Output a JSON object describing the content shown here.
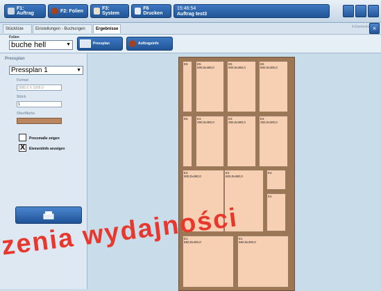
{
  "toolbar": {
    "buttons": [
      {
        "label": "F1: Auftrag",
        "icon": "notes-icon",
        "color": "#cfd7e0"
      },
      {
        "label": "F2: Folien",
        "icon": "folie-roll-icon",
        "color": "#a4421f"
      },
      {
        "label": "F3: System",
        "icon": "tools-icon",
        "color": "#e9e0c9"
      },
      {
        "label": "F6 Drucken",
        "icon": "printer-icon",
        "color": "#e6ecf2"
      }
    ],
    "clock_time": "15:46:54",
    "clock_order": "Auftrag test3"
  },
  "tabs": [
    "Stückliste",
    "Einstellungen - Buchungen",
    "Ergebnisse"
  ],
  "active_tab": "Ergebnisse",
  "elements_count": "4 Elements",
  "folien": {
    "label": "Folien",
    "value": "buche hell"
  },
  "buttons": {
    "pressplan": "Pressplan",
    "auftragsinfo": "Auftragsinfo"
  },
  "left": {
    "section": "Pressplan",
    "pressplan_value": "Pressplan 1",
    "format_label": "Format",
    "format_value": "2685.0 X 1005.0",
    "stuck_label": "Stück",
    "stuck_value": "1",
    "oberflaeche_label": "Oberfläche",
    "oberflaeche_color": "#b9865e",
    "checkbox1": {
      "label": "Pressmaße zeigen",
      "checked": false
    },
    "checkbox2": {
      "label": "Elementinfo anzeigen",
      "checked": true,
      "mark": "X"
    }
  },
  "pieces": [
    {
      "id": "E6",
      "text": "",
      "checked": false
    },
    {
      "id": "E5",
      "text": "500,0x480,0"
    },
    {
      "id": "E5b",
      "text": "500,0x480,0",
      "tag": "E5"
    },
    {
      "id": "E5c",
      "text": "600,0x400,0",
      "tag": "E5"
    },
    {
      "id": "E6b",
      "text": "",
      "tag": "E6"
    },
    {
      "id": "E3",
      "text": "250,0x480,0",
      "tag": "E3"
    },
    {
      "id": "E3b",
      "text": "250,0x480,0",
      "tag": "E3"
    },
    {
      "id": "E3c",
      "text": "250,0x400,0",
      "tag": "E3"
    },
    {
      "id": "E2",
      "text": "600,0x480,0",
      "tag": "E2"
    },
    {
      "id": "E2b",
      "text": "600,0x480,0",
      "tag": "E2"
    },
    {
      "id": "E4",
      "text": "",
      "tag": "E4"
    },
    {
      "id": "E4b",
      "text": "",
      "tag": "E4"
    },
    {
      "id": "E1",
      "text": "550,0x400,0",
      "tag": "E1"
    },
    {
      "id": "E1b",
      "text": "550,0x400,0",
      "tag": "E1"
    }
  ],
  "watermark": "zenia wydajności"
}
